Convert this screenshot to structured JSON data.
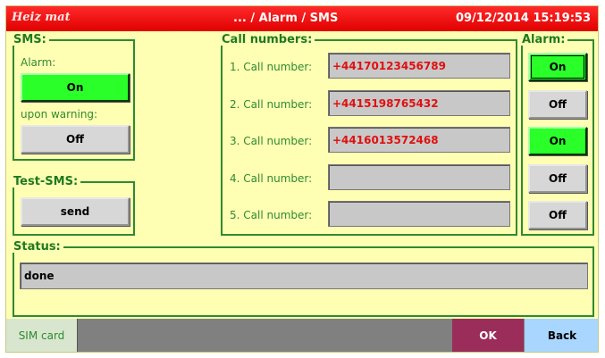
{
  "header": {
    "logo_text": "Heiz mat",
    "breadcrumb": "... / Alarm / SMS",
    "datetime": "09/12/2014 15:19:53"
  },
  "sms": {
    "legend": "SMS:",
    "alarm_label": "Alarm:",
    "alarm_button": "On",
    "warning_label": "upon warning:",
    "warning_button": "Off"
  },
  "test_sms": {
    "legend": "Test-SMS:",
    "send_button": "send"
  },
  "call_numbers": {
    "legend": "Call numbers:",
    "rows": [
      {
        "label": "1. Call number:",
        "value": "+44170123456789"
      },
      {
        "label": "2. Call number:",
        "value": "+4415198765432"
      },
      {
        "label": "3. Call number:",
        "value": "+4416013572468"
      },
      {
        "label": "4. Call number:",
        "value": ""
      },
      {
        "label": "5. Call number:",
        "value": ""
      }
    ]
  },
  "alarm": {
    "legend": "Alarm:",
    "buttons": [
      "On",
      "Off",
      "On",
      "Off",
      "Off"
    ]
  },
  "status": {
    "legend": "Status:",
    "value": "done"
  },
  "footer": {
    "sim_card": "SIM card",
    "ok": "OK",
    "back": "Back"
  },
  "colors": {
    "title_bar": "#e00000",
    "panel_bg": "#ffffb4",
    "frame_green": "#2f8a2f",
    "on_green": "#2aff2a",
    "number_red": "#e01010",
    "ok_bg": "#9a2d5a",
    "back_bg": "#a8d6ff"
  }
}
